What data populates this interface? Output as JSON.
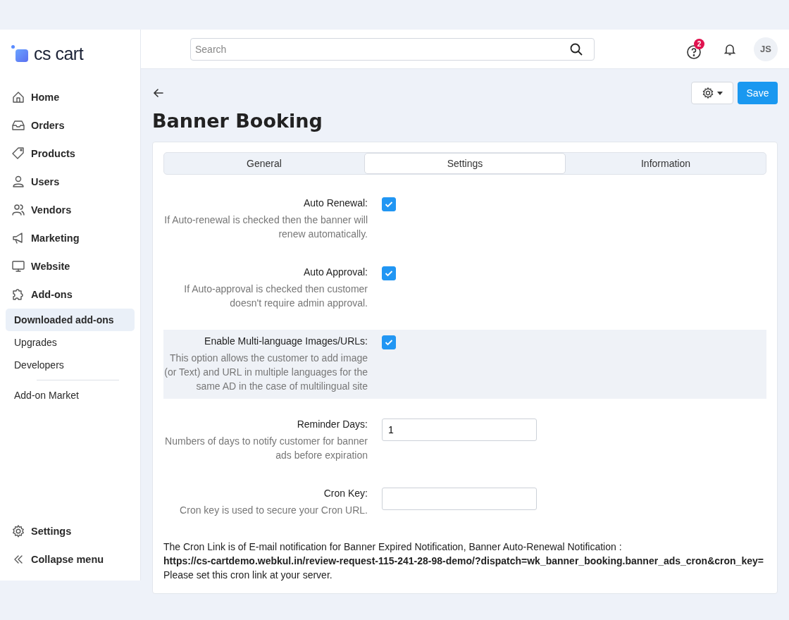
{
  "logo": {
    "text": "cs cart"
  },
  "sidebar": {
    "items": [
      {
        "label": "Home"
      },
      {
        "label": "Orders"
      },
      {
        "label": "Products"
      },
      {
        "label": "Users"
      },
      {
        "label": "Vendors"
      },
      {
        "label": "Marketing"
      },
      {
        "label": "Website"
      },
      {
        "label": "Add-ons"
      }
    ],
    "subitems": [
      {
        "label": "Downloaded add-ons",
        "selected": true
      },
      {
        "label": "Upgrades",
        "selected": false
      },
      {
        "label": "Developers",
        "selected": false
      },
      {
        "label": "Add-on Market",
        "selected": false
      }
    ],
    "bottom_items": [
      {
        "label": "Settings"
      },
      {
        "label": "Collapse menu"
      }
    ]
  },
  "header": {
    "search": {
      "placeholder": "Search"
    },
    "help_badge": "2",
    "avatar": "JS"
  },
  "page": {
    "title": "Banner Booking",
    "save_button": "Save"
  },
  "tabs": [
    {
      "label": "General",
      "selected": false
    },
    {
      "label": "Settings",
      "selected": true
    },
    {
      "label": "Information",
      "selected": false
    }
  ],
  "settings": [
    {
      "kind": "checkbox",
      "label": "Auto Renewal:",
      "hint": "If Auto-renewal is checked then the banner will renew automatically.",
      "checked": true,
      "highlighted": false
    },
    {
      "kind": "checkbox",
      "label": "Auto Approval:",
      "hint": "If Auto-approval is checked then customer doesn't require admin approval.",
      "checked": true,
      "highlighted": false
    },
    {
      "kind": "checkbox",
      "label": "Enable Multi-language Images/URLs:",
      "hint": "This option allows the customer to add image (or Text) and URL in multiple languages for the same AD in the case of multilingual site",
      "checked": true,
      "highlighted": true
    },
    {
      "kind": "input",
      "label": "Reminder Days:",
      "hint": "Numbers of days to notify customer for banner ads before expiration",
      "value": "1",
      "highlighted": false
    },
    {
      "kind": "input",
      "label": "Cron Key:",
      "hint": "Cron key is used to secure your Cron URL.",
      "highlighted": false
    }
  ],
  "cron_note": {
    "intro": "The Cron Link is of E-mail notification for Banner Expired Notification, Banner Auto-Renewal Notification :",
    "url": "https://cs-cartdemo.webkul.in/review-request-115-241-28-98-demo/?dispatch=wk_banner_booking.banner_ads_cron&cron_key=",
    "footer": "Please set this cron link at your server."
  }
}
